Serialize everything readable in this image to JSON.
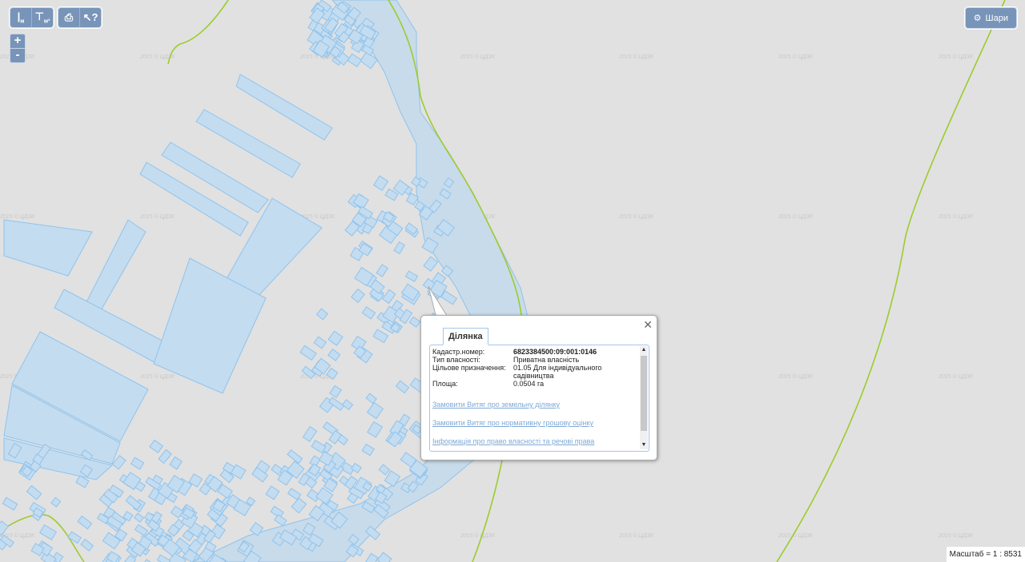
{
  "toolbar": {
    "buttons": [
      {
        "name": "measure-length-button",
        "icon": "ruler-icon",
        "glyph": "|",
        "sub": "м"
      },
      {
        "name": "measure-area-button",
        "icon": "area-icon",
        "glyph": "⊤",
        "sub": "м²"
      }
    ],
    "buttons2": [
      {
        "name": "print-button",
        "icon": "print-icon",
        "glyph": "⎙"
      },
      {
        "name": "identify-button",
        "icon": "cursor-help-icon",
        "glyph": "↖?"
      }
    ]
  },
  "zoom": {
    "in": "+",
    "out": "-"
  },
  "layers_button": {
    "label": "Шари",
    "icon": "gear-icon"
  },
  "watermark": "2015 © ЦДЗК",
  "popup": {
    "tab": "Ділянка",
    "fields": [
      {
        "label": "Кадастр.номер:",
        "value": "6823384500:09:001:0146",
        "bold": true
      },
      {
        "label": "Тип власності:",
        "value": "Приватна власність"
      },
      {
        "label": "Цільове призначення:",
        "value": "01.05 Для індивідуального садівництва"
      },
      {
        "label": "Площа:",
        "value": "0.0504 га"
      }
    ],
    "links": [
      "Замовити Витяг про земельну ділянку",
      "Замовити Витяг про нормативну грошову оцінку",
      "Інформація про право власності та речові права"
    ]
  },
  "scale": "Масштаб = 1 : 8531",
  "colors": {
    "map_bg": "#e1e1e1",
    "parcel_fill": "#c4dcf0",
    "parcel_stroke": "#8fc3ec",
    "river": "#c8dbea",
    "boundary": "#9ccc2c",
    "ui": "#7894b8"
  }
}
